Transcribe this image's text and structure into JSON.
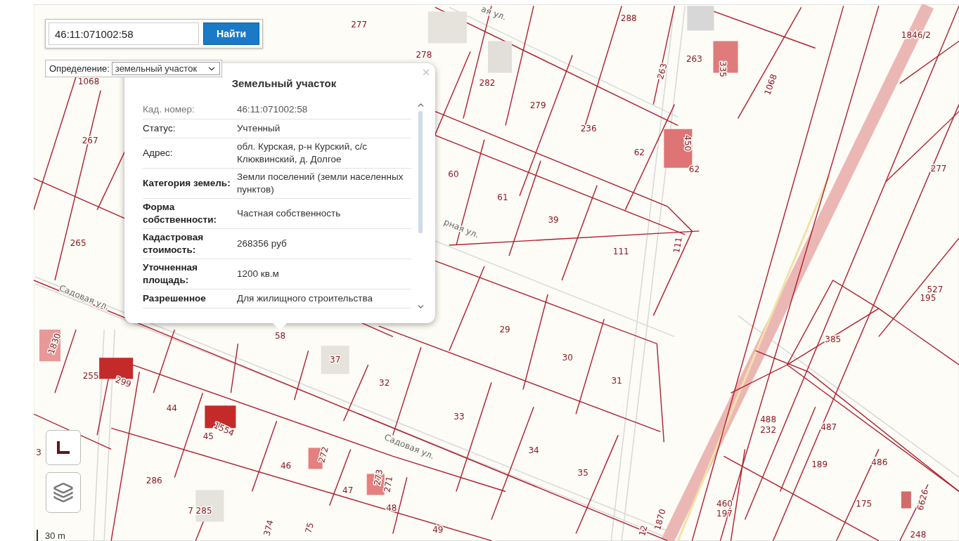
{
  "search": {
    "value": "46:11:071002:58",
    "button": "Найти"
  },
  "definition": {
    "label": "Определение:",
    "value": "земельный участок"
  },
  "popup": {
    "title": "Земельный участок",
    "rows": [
      {
        "label": "Кад. номер:",
        "value": "46:11:071002:58",
        "kind": "muted"
      },
      {
        "label": "Статус:",
        "value": "Учтенный",
        "kind": "plain"
      },
      {
        "label": "Адрес:",
        "value": "обл. Курская, р-н Курский, с/с Клюквинский, д. Долгое",
        "kind": "plain"
      },
      {
        "label": "Категория земель:",
        "value": "Земли поселений (земли населенных пунктов)",
        "kind": "strong"
      },
      {
        "label": "Форма собственности:",
        "value": "Частная собственность",
        "kind": "strong"
      },
      {
        "label": "Кадастровая стоимость:",
        "value": "268356 руб",
        "kind": "strong"
      },
      {
        "label": "Уточненная площадь:",
        "value": "1200 кв.м",
        "kind": "strong"
      },
      {
        "label": "Разрешенное",
        "value": "Для жилищного строительства",
        "kind": "strong"
      }
    ]
  },
  "parcels": [
    {
      "text": "277"
    },
    {
      "text": "278"
    },
    {
      "text": "288"
    },
    {
      "text": "263"
    },
    {
      "text": "335"
    },
    {
      "text": "1846/2"
    },
    {
      "text": "1068"
    },
    {
      "text": "1068"
    },
    {
      "text": "263"
    },
    {
      "text": "282"
    },
    {
      "text": "279"
    },
    {
      "text": "236"
    },
    {
      "text": "62"
    },
    {
      "text": "450"
    },
    {
      "text": "62"
    },
    {
      "text": "267"
    },
    {
      "text": "60"
    },
    {
      "text": "61"
    },
    {
      "text": "39"
    },
    {
      "text": "111"
    },
    {
      "text": "111"
    },
    {
      "text": "277"
    },
    {
      "text": "265"
    },
    {
      "text": "527"
    },
    {
      "text": "195"
    },
    {
      "text": "385"
    },
    {
      "text": "29"
    },
    {
      "text": "30"
    },
    {
      "text": "31"
    },
    {
      "text": "58"
    },
    {
      "text": "37"
    },
    {
      "text": "32"
    },
    {
      "text": "33"
    },
    {
      "text": "34"
    },
    {
      "text": "35"
    },
    {
      "text": "255"
    },
    {
      "text": "299"
    },
    {
      "text": "1830"
    },
    {
      "text": "44"
    },
    {
      "text": "45"
    },
    {
      "text": "1554"
    },
    {
      "text": "46"
    },
    {
      "text": "272"
    },
    {
      "text": "47"
    },
    {
      "text": "273"
    },
    {
      "text": "271"
    },
    {
      "text": "48"
    },
    {
      "text": "49"
    },
    {
      "text": "286"
    },
    {
      "text": "7 285"
    },
    {
      "text": "374"
    },
    {
      "text": "488"
    },
    {
      "text": "232"
    },
    {
      "text": "487"
    },
    {
      "text": "189"
    },
    {
      "text": "486"
    },
    {
      "text": "175"
    },
    {
      "text": "6626"
    },
    {
      "text": "248"
    },
    {
      "text": "460"
    },
    {
      "text": "197"
    },
    {
      "text": "1870"
    },
    {
      "text": "12"
    },
    {
      "text": "3"
    },
    {
      "text": "75"
    }
  ],
  "streets": [
    {
      "text": "Садовая ул."
    },
    {
      "text": "Садовая ул."
    },
    {
      "text": "ая ул."
    },
    {
      "text": "рная ул."
    }
  ],
  "scale": "30 m"
}
